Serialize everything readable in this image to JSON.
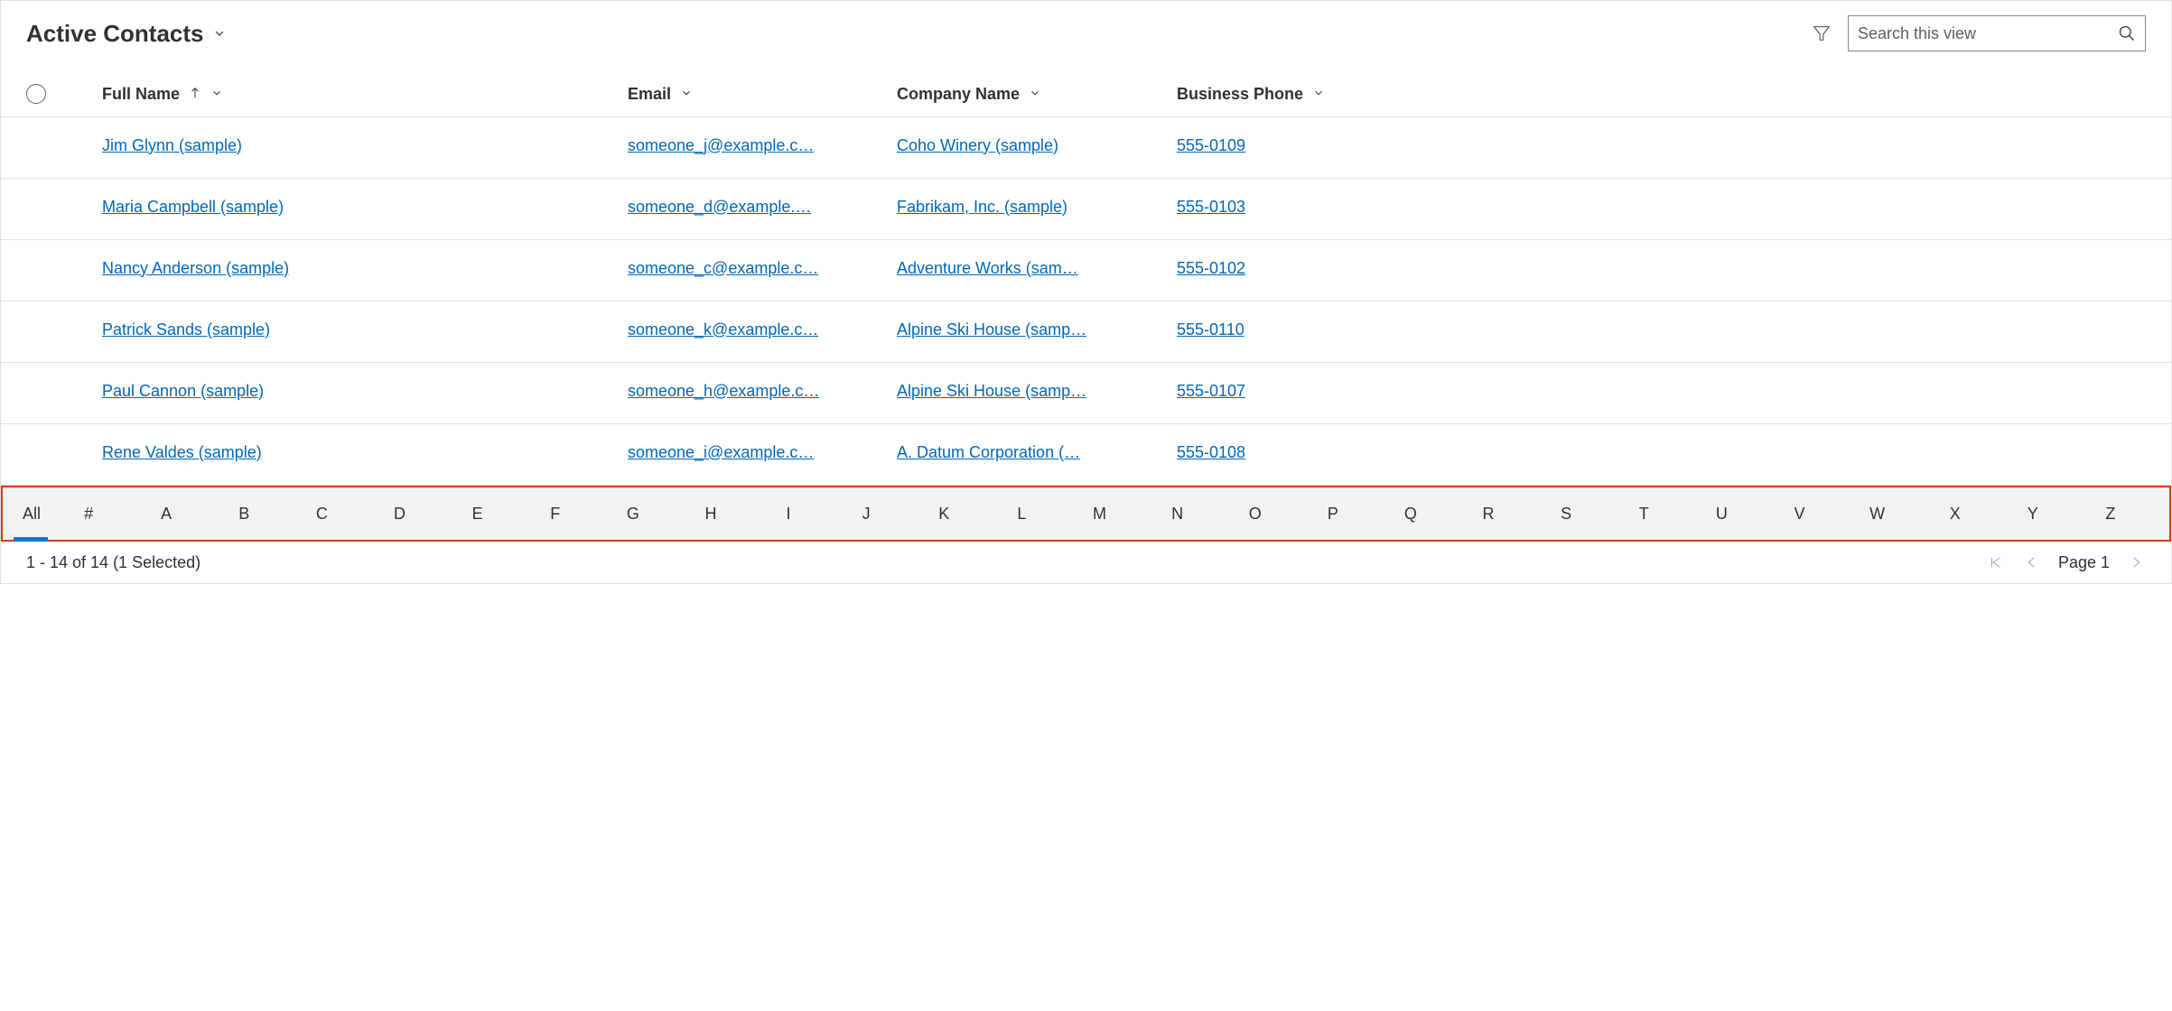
{
  "view": {
    "title": "Active Contacts"
  },
  "search": {
    "placeholder": "Search this view"
  },
  "columns": {
    "fullname": "Full Name",
    "email": "Email",
    "company": "Company Name",
    "phone": "Business Phone"
  },
  "rows": [
    {
      "fullname": "Jim Glynn (sample)",
      "email": "someone_j@example.c…",
      "company": "Coho Winery (sample)",
      "phone": "555-0109"
    },
    {
      "fullname": "Maria Campbell (sample)",
      "email": "someone_d@example.…",
      "company": "Fabrikam, Inc. (sample)",
      "phone": "555-0103"
    },
    {
      "fullname": "Nancy Anderson (sample)",
      "email": "someone_c@example.c…",
      "company": "Adventure Works (sam…",
      "phone": "555-0102"
    },
    {
      "fullname": "Patrick Sands (sample)",
      "email": "someone_k@example.c…",
      "company": "Alpine Ski House (samp…",
      "phone": "555-0110"
    },
    {
      "fullname": "Paul Cannon (sample)",
      "email": "someone_h@example.c…",
      "company": "Alpine Ski House (samp…",
      "phone": "555-0107"
    },
    {
      "fullname": "Rene Valdes (sample)",
      "email": "someone_i@example.c…",
      "company": "A. Datum Corporation (…",
      "phone": "555-0108"
    }
  ],
  "alpha": {
    "items": [
      "All",
      "#",
      "A",
      "B",
      "C",
      "D",
      "E",
      "F",
      "G",
      "H",
      "I",
      "J",
      "K",
      "L",
      "M",
      "N",
      "O",
      "P",
      "Q",
      "R",
      "S",
      "T",
      "U",
      "V",
      "W",
      "X",
      "Y",
      "Z"
    ],
    "active": "All"
  },
  "footer": {
    "status": "1 - 14 of 14 (1 Selected)",
    "page_label": "Page 1"
  }
}
